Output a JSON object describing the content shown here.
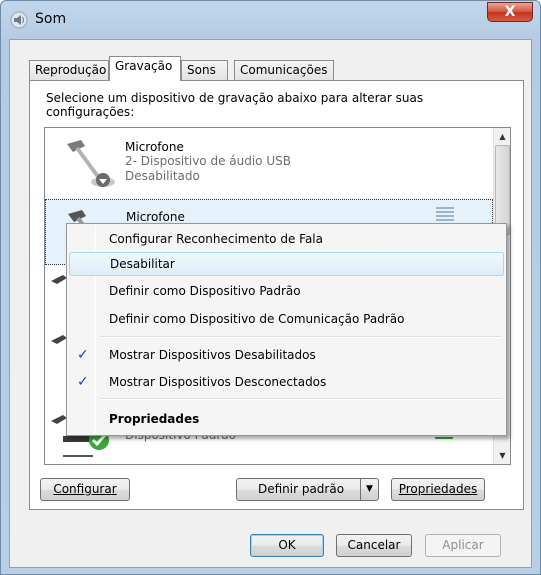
{
  "window": {
    "title": "Som",
    "close_label": "X"
  },
  "tabs": [
    "Reprodução",
    "Gravação",
    "Sons",
    "Comunicações"
  ],
  "instructions": "Selecione um dispositivo de gravação abaixo para alterar suas configurações:",
  "devices": [
    {
      "name": "Microfone",
      "sub1": "2- Dispositivo de áudio USB",
      "sub2": "Desabilitado"
    },
    {
      "name": "Microfone",
      "sub1": "",
      "sub2": ""
    },
    {
      "name": "",
      "sub1": "Dispositivo Padrão",
      "sub2": ""
    }
  ],
  "context_menu": {
    "items": [
      "Configurar Reconhecimento de Fala",
      "Desabilitar",
      "Definir como Dispositivo Padrão",
      "Definir como Dispositivo de Comunicação Padrão",
      "Mostrar Dispositivos Desabilitados",
      "Mostrar Dispositivos Desconectados",
      "Propriedades"
    ],
    "checks": [
      "✓",
      "✓"
    ]
  },
  "buttons": {
    "configure": "Configurar",
    "set_default": "Definir padrão",
    "properties": "Propriedades",
    "ok": "OK",
    "cancel": "Cancelar",
    "apply": "Aplicar"
  }
}
